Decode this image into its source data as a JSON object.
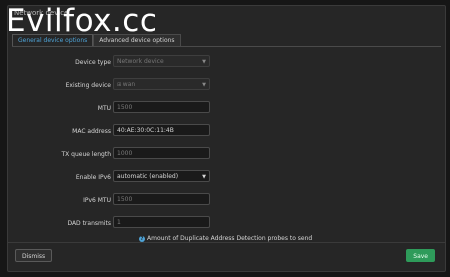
{
  "watermark": "Evilfox.cc",
  "modal": {
    "title": "Network device"
  },
  "tabs": [
    {
      "label": "General device options",
      "active": true
    },
    {
      "label": "Advanced device options",
      "active": false
    }
  ],
  "fields": {
    "device_type": {
      "label": "Device type",
      "value": "Network device"
    },
    "existing_device": {
      "label": "Existing device",
      "value": "wan"
    },
    "mtu": {
      "label": "MTU",
      "placeholder": "1500"
    },
    "mac_address": {
      "label": "MAC address",
      "value": "40:AE:30:0C:11:4B"
    },
    "tx_queue_length": {
      "label": "TX queue length",
      "placeholder": "1000"
    },
    "enable_ipv6": {
      "label": "Enable IPv6",
      "value": "automatic (enabled)"
    },
    "ipv6_mtu": {
      "label": "IPv6 MTU",
      "placeholder": "1500"
    },
    "dad_transmits": {
      "label": "DAD transmits",
      "placeholder": "1"
    }
  },
  "hint": "Amount of Duplicate Address Detection probes to send",
  "buttons": {
    "dismiss": "Dismiss",
    "save": "Save"
  },
  "colors": {
    "accent": "#4fa3d6",
    "save": "#2e9b5a",
    "background": "#262626"
  }
}
